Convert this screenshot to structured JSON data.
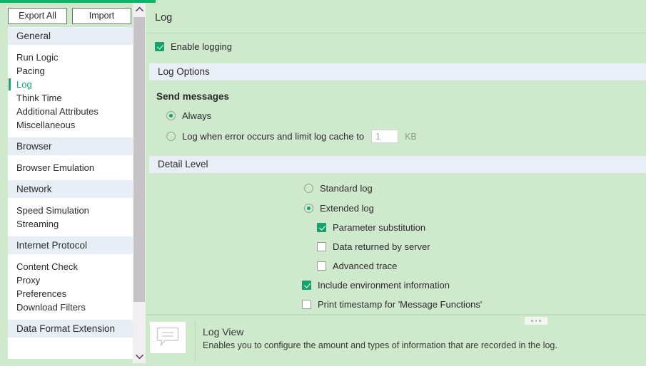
{
  "theme": {
    "background": "#cfe9cd",
    "accent_green": "#0fb36a",
    "control_green": "#17a06a",
    "section_bar": "#e9eff6",
    "panel_white": "#ffffff"
  },
  "toolbar": {
    "export_all_label": "Export All",
    "import_label": "Import"
  },
  "sidebar": {
    "scrollbar": {
      "up_icon": "chevron-up-icon",
      "down_icon": "chevron-down-icon"
    },
    "sections": [
      {
        "group": "General",
        "items": [
          {
            "label": "Run Logic",
            "active": false
          },
          {
            "label": "Pacing",
            "active": false
          },
          {
            "label": "Log",
            "active": true
          },
          {
            "label": "Think Time",
            "active": false
          },
          {
            "label": "Additional Attributes",
            "active": false
          },
          {
            "label": "Miscellaneous",
            "active": false
          }
        ]
      },
      {
        "group": "Browser",
        "items": [
          {
            "label": "Browser Emulation",
            "active": false
          }
        ]
      },
      {
        "group": "Network",
        "items": [
          {
            "label": "Speed Simulation",
            "active": false
          },
          {
            "label": "Streaming",
            "active": false
          }
        ]
      },
      {
        "group": "Internet Protocol",
        "items": [
          {
            "label": "Content Check",
            "active": false
          },
          {
            "label": "Proxy",
            "active": false
          },
          {
            "label": "Preferences",
            "active": false
          },
          {
            "label": "Download Filters",
            "active": false
          }
        ]
      },
      {
        "group": "Data Format Extension",
        "items": []
      }
    ]
  },
  "main": {
    "page_title": "Log",
    "enable_logging": {
      "label": "Enable logging",
      "checked": true
    },
    "log_options": {
      "section_title": "Log Options",
      "group_label": "Send messages",
      "radios": [
        {
          "label": "Always",
          "selected": true
        },
        {
          "label": "Log when error occurs and limit log cache to",
          "selected": false
        }
      ],
      "cache_input": {
        "value": "1",
        "placeholder": "1",
        "unit": "KB",
        "disabled": true
      }
    },
    "detail_level": {
      "section_title": "Detail Level",
      "radios": [
        {
          "label": "Standard log",
          "selected": false
        },
        {
          "label": "Extended log",
          "selected": true
        }
      ],
      "sub_checks": [
        {
          "label": "Parameter substitution",
          "checked": true
        },
        {
          "label": "Data returned by server",
          "checked": false
        },
        {
          "label": "Advanced trace",
          "checked": false
        }
      ],
      "checks": [
        {
          "label": "Include environment information",
          "checked": true
        },
        {
          "label": "Print timestamp for 'Message Functions'",
          "checked": false
        }
      ]
    }
  },
  "info_panel": {
    "icon": "speech-bubble-icon",
    "title": "Log View",
    "description": "Enables you to configure the amount and types of information that are recorded in the log.",
    "drag_handle": "resize-dots-handle"
  }
}
